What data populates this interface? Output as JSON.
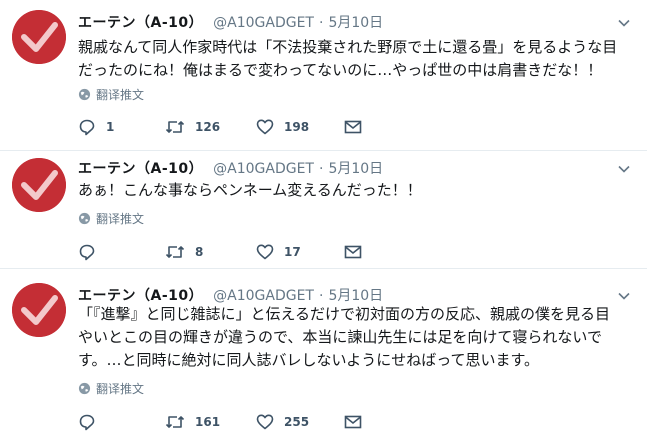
{
  "translate_label": "翻译推文",
  "tweets": [
    {
      "name": "エーテン（A-10）",
      "handle": "@A10GADGET",
      "separator": "·",
      "date": "5月10日",
      "lines": [
        "親戚なんて同人作家時代は「不法投棄された野原で土に還る畳」を見るような目",
        "だったのにね！俺はまるで変わってないのに…やっぱ世の中は肩書きだな！！"
      ],
      "replies": "1",
      "retweets": "126",
      "likes": "198"
    },
    {
      "name": "エーテン（A-10）",
      "handle": "@A10GADGET",
      "separator": "·",
      "date": "5月10日",
      "lines": [
        "あぁ！こんな事ならペンネーム変えるんだった！！"
      ],
      "replies": "",
      "retweets": "8",
      "likes": "17"
    },
    {
      "name": "エーテン（A-10）",
      "handle": "@A10GADGET",
      "separator": "·",
      "date": "5月10日",
      "lines": [
        "「『進撃』と同じ雑誌に」と伝えるだけで初対面の方の反応、親戚の僕を見る目",
        "やいとこの目の輝きが違うので、本当に諫山先生には足を向けて寝られないで",
        "す。…と同時に絶対に同人誌バレしないようにせねばって思います。"
      ],
      "replies": "",
      "retweets": "161",
      "likes": "255"
    }
  ],
  "colors": {
    "avatar_bg": "#c42e35",
    "text": "#14171a",
    "secondary": "#657786",
    "divider": "#e6ecf0"
  },
  "icons": [
    "checkmark-avatar",
    "chevron-down-icon",
    "globe-icon",
    "reply-icon",
    "retweet-icon",
    "like-icon",
    "message-icon"
  ]
}
